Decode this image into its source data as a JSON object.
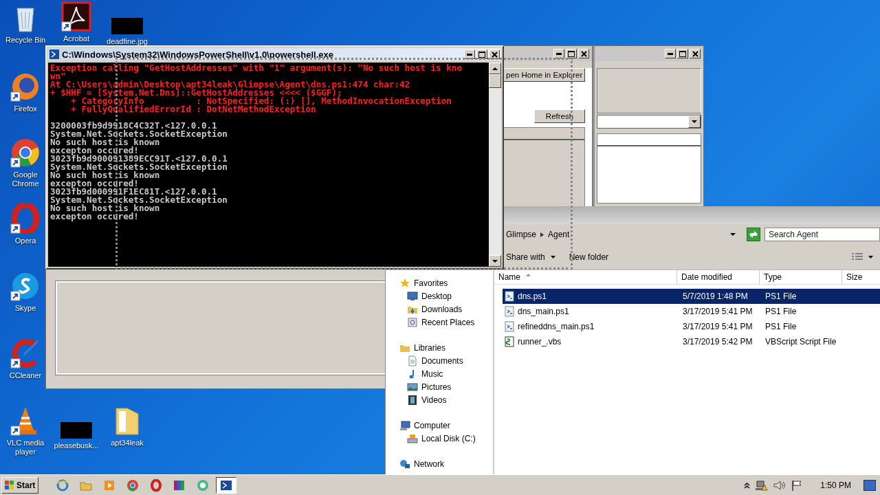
{
  "desktop": {
    "icons": [
      {
        "label": "Recycle Bin",
        "kind": "recycle",
        "shortcut": false
      },
      {
        "label": "Acrobat",
        "kind": "acrobat",
        "shortcut": true
      },
      {
        "label": "deadfine.jpg",
        "kind": "image",
        "shortcut": false
      },
      {
        "label": "Firefox",
        "kind": "firefox",
        "shortcut": true
      },
      {
        "label": "Google Chrome",
        "kind": "chrome",
        "shortcut": true
      },
      {
        "label": "Opera",
        "kind": "opera",
        "shortcut": true
      },
      {
        "label": "Skype",
        "kind": "skype",
        "shortcut": true
      },
      {
        "label": "CCleaner",
        "kind": "ccleaner",
        "shortcut": true
      },
      {
        "label": "VLC media player",
        "kind": "vlc",
        "shortcut": true
      },
      {
        "label": "pleasebusk...",
        "kind": "image",
        "shortcut": false
      },
      {
        "label": "apt34leak",
        "kind": "folder",
        "shortcut": false
      }
    ]
  },
  "app_window": {
    "buttons": [
      "pen Home in Explorer",
      "Refresh"
    ]
  },
  "explorer": {
    "breadcrumbs": [
      "Glimpse",
      "Agent"
    ],
    "search": {
      "placeholder": "Search Agent"
    },
    "toolbar": [
      {
        "label": "Share with",
        "dropdown": true
      },
      {
        "label": "New folder",
        "dropdown": false
      }
    ],
    "nav": [
      {
        "label": "Favorites",
        "kind": "star",
        "children": [
          {
            "label": "Desktop",
            "kind": "desktop"
          },
          {
            "label": "Downloads",
            "kind": "downloads"
          },
          {
            "label": "Recent Places",
            "kind": "recent"
          }
        ]
      },
      {
        "label": "Libraries",
        "kind": "libraries",
        "children": [
          {
            "label": "Documents",
            "kind": "document"
          },
          {
            "label": "Music",
            "kind": "music"
          },
          {
            "label": "Pictures",
            "kind": "pictures"
          },
          {
            "label": "Videos",
            "kind": "videos"
          }
        ]
      },
      {
        "label": "Computer",
        "kind": "computer",
        "children": [
          {
            "label": "Local Disk (C:)",
            "kind": "disk"
          }
        ]
      },
      {
        "label": "Network",
        "kind": "network"
      }
    ],
    "columns": [
      {
        "label": "Name",
        "sorted": true
      },
      {
        "label": "Date modified",
        "sorted": false
      },
      {
        "label": "Type",
        "sorted": false
      },
      {
        "label": "Size",
        "sorted": false
      }
    ],
    "files": [
      {
        "name": "dns.ps1",
        "date": "5/7/2019 1:48 PM",
        "type": "PS1 File",
        "kind": "ps1",
        "selected": true
      },
      {
        "name": "dns_main.ps1",
        "date": "3/17/2019 5:41 PM",
        "type": "PS1 File",
        "kind": "ps1",
        "selected": false
      },
      {
        "name": "refineddns_main.ps1",
        "date": "3/17/2019 5:41 PM",
        "type": "PS1 File",
        "kind": "ps1",
        "selected": false
      },
      {
        "name": "runner_.vbs",
        "date": "3/17/2019 5:42 PM",
        "type": "VBScript Script File",
        "kind": "vbs",
        "selected": false
      }
    ]
  },
  "console": {
    "title": "C:\\Windows\\System32\\WindowsPowerShell\\v1.0\\powershell.exe",
    "lines": [
      {
        "text": "Exception calling \"GetHostAddresses\" with \"1\" argument(s): \"No such host is kno",
        "kind": "error"
      },
      {
        "text": "wn\"",
        "kind": "error"
      },
      {
        "text": "At C:\\Users\\admin\\Desktop\\apt34leak\\Glimpse\\Agent\\dns.ps1:474 char:42",
        "kind": "error"
      },
      {
        "text": "+ $HHF = [System.Net.Dns]::GetHostAddresses <<<< ($GGF);",
        "kind": "error"
      },
      {
        "text": "    + CategoryInfo          : NotSpecified: (:) [], MethodInvocationException",
        "kind": "error"
      },
      {
        "text": "    + FullyQualifiedErrorId : DotNetMethodException",
        "kind": "error"
      },
      {
        "text": "3200003fb9d9918C4C32T.<127.0.0.1",
        "kind": "output"
      },
      {
        "text": "System.Net.Sockets.SocketException",
        "kind": "output"
      },
      {
        "text": "No such host is known",
        "kind": "output"
      },
      {
        "text": "excepton occured!",
        "kind": "output"
      },
      {
        "text": "3023fb9d900091389ECC91T.<127.0.0.1",
        "kind": "output"
      },
      {
        "text": "System.Net.Sockets.SocketException",
        "kind": "output"
      },
      {
        "text": "No such host is known",
        "kind": "output"
      },
      {
        "text": "excepton occured!",
        "kind": "output"
      },
      {
        "text": "3023fb9d000991F1EC81T.<127.0.0.1",
        "kind": "output"
      },
      {
        "text": "System.Net.Sockets.SocketException",
        "kind": "output"
      },
      {
        "text": "No such host is known",
        "kind": "output"
      },
      {
        "text": "excepton occured!",
        "kind": "output"
      }
    ]
  },
  "taskbar": {
    "start": "Start",
    "apps": [
      {
        "kind": "ie",
        "active": false
      },
      {
        "kind": "explorer",
        "active": false
      },
      {
        "kind": "media",
        "active": false
      },
      {
        "kind": "chrome",
        "active": false
      },
      {
        "kind": "opera",
        "active": false
      },
      {
        "kind": "winrar",
        "active": false
      },
      {
        "kind": "green",
        "active": false
      },
      {
        "kind": "powershell",
        "active": true
      }
    ],
    "clock": "1:50 PM"
  }
}
